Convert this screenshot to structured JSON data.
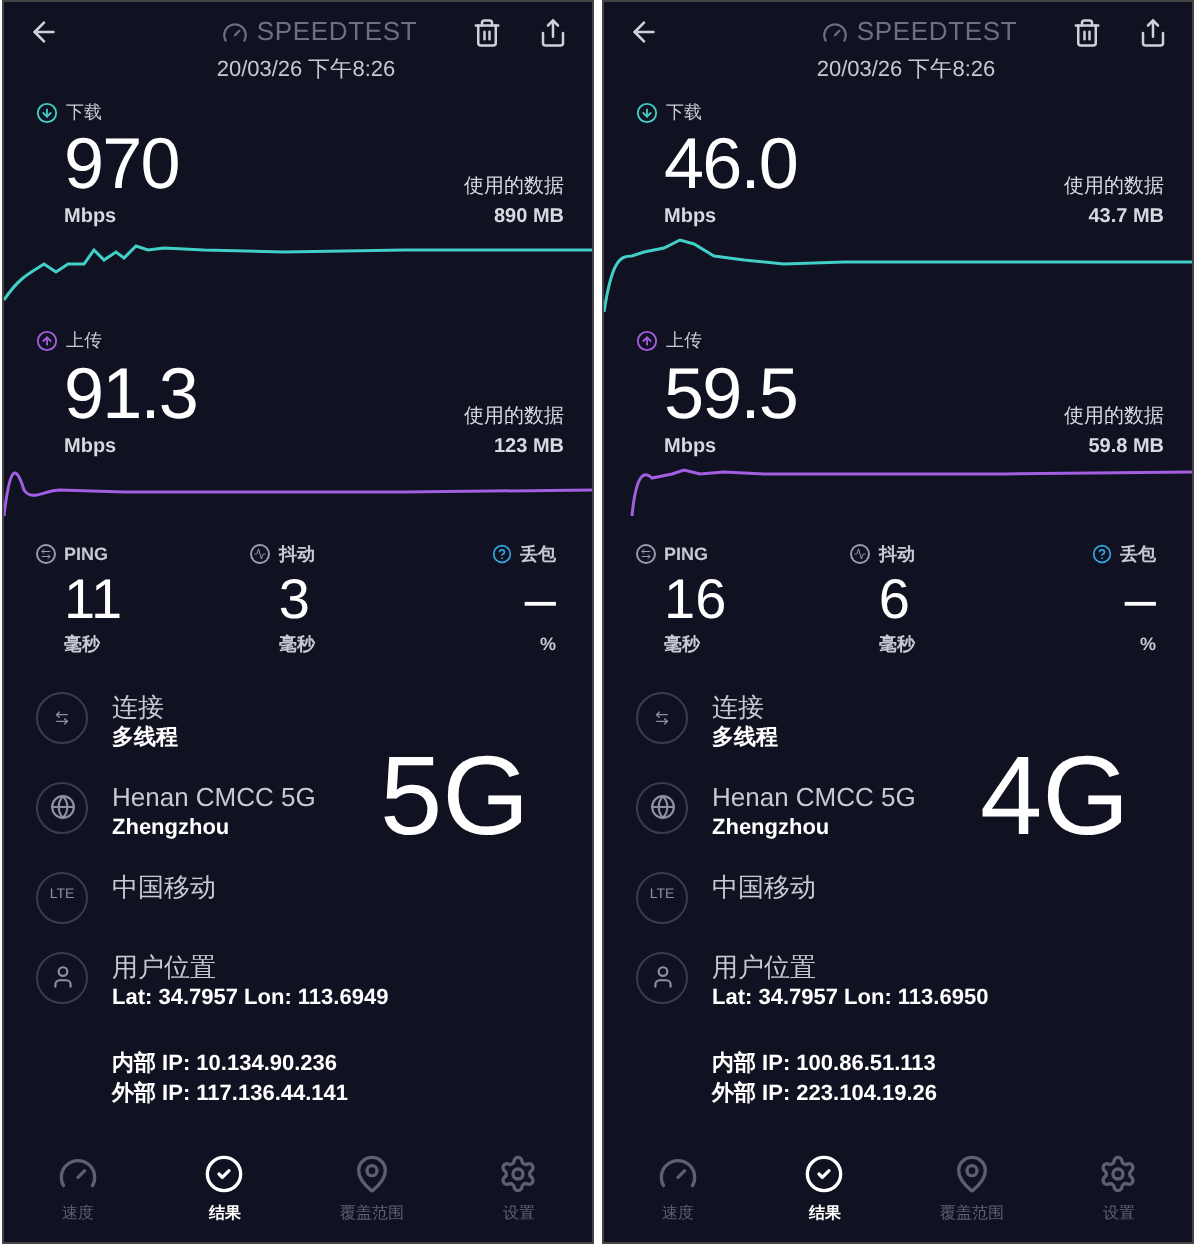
{
  "panels": [
    {
      "title": "SPEEDTEST",
      "timestamp": "20/03/26 下午8:26",
      "download": {
        "label": "下载",
        "value": "970",
        "unit": "Mbps",
        "data_label": "使用的数据",
        "data_value": "890 MB"
      },
      "upload": {
        "label": "上传",
        "value": "91.3",
        "unit": "Mbps",
        "data_label": "使用的数据",
        "data_value": "123 MB"
      },
      "metrics": [
        {
          "kind": "ping",
          "label": "PING",
          "value": "11",
          "unit": "毫秒"
        },
        {
          "kind": "jitter",
          "label": "抖动",
          "value": "3",
          "unit": "毫秒"
        },
        {
          "kind": "loss",
          "label": "丢包",
          "value": "–",
          "unit": "%"
        }
      ],
      "network_badge": "5G",
      "details": [
        {
          "kind": "connection",
          "title": "连接",
          "subtitle": "多线程"
        },
        {
          "kind": "server",
          "title": "Henan CMCC 5G",
          "subtitle": "Zhengzhou"
        },
        {
          "kind": "carrier",
          "icon_text": "LTE",
          "title": "中国移动"
        },
        {
          "kind": "location",
          "title": "用户位置",
          "subtitle": "Lat: 34.7957 Lon: 113.6949"
        }
      ],
      "ip_lines": [
        "内部 IP: 10.134.90.236",
        "外部 IP: 117.136.44.141"
      ],
      "tabs": [
        {
          "kind": "speed",
          "label": "速度",
          "selected": false
        },
        {
          "kind": "results",
          "label": "结果",
          "selected": true
        },
        {
          "kind": "coverage",
          "label": "覆盖范围",
          "selected": false
        },
        {
          "kind": "settings",
          "label": "设置",
          "selected": false
        }
      ]
    },
    {
      "title": "SPEEDTEST",
      "timestamp": "20/03/26 下午8:26",
      "download": {
        "label": "下载",
        "value": "46.0",
        "unit": "Mbps",
        "data_label": "使用的数据",
        "data_value": "43.7 MB"
      },
      "upload": {
        "label": "上传",
        "value": "59.5",
        "unit": "Mbps",
        "data_label": "使用的数据",
        "data_value": "59.8 MB"
      },
      "metrics": [
        {
          "kind": "ping",
          "label": "PING",
          "value": "16",
          "unit": "毫秒"
        },
        {
          "kind": "jitter",
          "label": "抖动",
          "value": "6",
          "unit": "毫秒"
        },
        {
          "kind": "loss",
          "label": "丢包",
          "value": "–",
          "unit": "%"
        }
      ],
      "network_badge": "4G",
      "details": [
        {
          "kind": "connection",
          "title": "连接",
          "subtitle": "多线程"
        },
        {
          "kind": "server",
          "title": "Henan CMCC 5G",
          "subtitle": "Zhengzhou"
        },
        {
          "kind": "carrier",
          "icon_text": "LTE",
          "title": "中国移动"
        },
        {
          "kind": "location",
          "title": "用户位置",
          "subtitle": "Lat: 34.7957 Lon: 113.6950"
        }
      ],
      "ip_lines": [
        "内部 IP: 100.86.51.113",
        "外部 IP: 223.104.19.26"
      ],
      "tabs": [
        {
          "kind": "speed",
          "label": "速度",
          "selected": false
        },
        {
          "kind": "results",
          "label": "结果",
          "selected": true
        },
        {
          "kind": "coverage",
          "label": "覆盖范围",
          "selected": false
        },
        {
          "kind": "settings",
          "label": "设置",
          "selected": false
        }
      ]
    }
  ]
}
